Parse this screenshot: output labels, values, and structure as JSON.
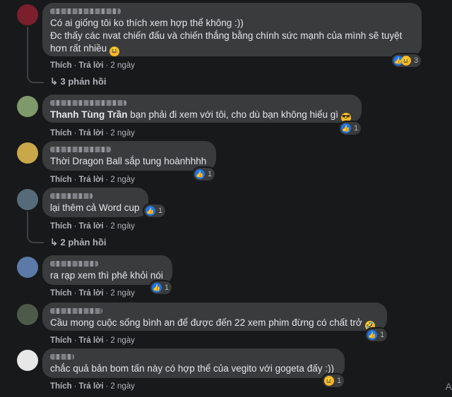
{
  "actions": {
    "like": "Thích",
    "reply": "Trả lời",
    "dot": "·"
  },
  "comments": [
    {
      "text": "Có ai giống tôi ko thích xem hợp thể không :))\nĐc thấy các nvat chiến đấu và chiến thắng bằng chính sức mạnh của mình sẽ tuyệt hơn rất nhiều",
      "emoji": "😆",
      "time": "2 ngày",
      "reaction_count": "3",
      "reactions": [
        "like-icon",
        "haha-icon"
      ],
      "replies": "3 phản hồi"
    },
    {
      "mention": "Thanh Tùng Trần",
      "text": " bạn phải đi xem với tôi, cho dù bạn không hiểu gì",
      "emoji": "😎",
      "time": "2 ngày",
      "reaction_count": "1",
      "reactions": [
        "like-icon"
      ]
    },
    {
      "text": "Thời Dragon Ball sắp tung hoànhhhh",
      "time": "2 ngày",
      "reaction_count": "1",
      "reactions": [
        "like-icon"
      ]
    },
    {
      "text": "lại thêm cả Word cup",
      "time": "2 ngày",
      "reaction_count": "1",
      "reactions": [
        "like-icon"
      ],
      "replies": "2 phản hồi"
    },
    {
      "text": "ra rạp xem thì phê khỏi nói",
      "time": "2 ngày",
      "reaction_count": "1",
      "reactions": [
        "like-icon"
      ]
    },
    {
      "text": "Cầu mong cuộc sống bình an để được đến 22 xem phim đừng có chất trở",
      "emoji": "🤣",
      "time": "2 ngày",
      "reaction_count": "1",
      "reactions": [
        "like-icon"
      ]
    },
    {
      "text": "chắc quả bản bom tấn này có hợp thể của vegito với gogeta đấy :))",
      "time": "2 ngày",
      "reaction_count": "1",
      "reactions": [
        "haha-icon"
      ]
    }
  ],
  "edge_letter": "A",
  "colors": {
    "background": "#18191a",
    "bubble": "#3a3b3c",
    "like": "#1877f2",
    "haha": "#f7b928",
    "meta": "#b0b3b8"
  }
}
